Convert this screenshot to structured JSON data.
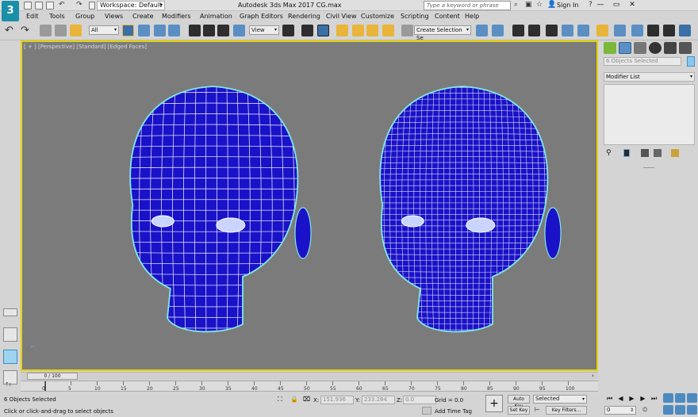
{
  "app": {
    "workspace": "Workspace: Default",
    "title": "Autodesk 3ds Max 2017     CG.max",
    "search_placeholder": "Type a keyword or phrase",
    "signin": "Sign In",
    "logo": "3"
  },
  "menu": [
    "Edit",
    "Tools",
    "Group",
    "Views",
    "Create",
    "Modifiers",
    "Animation",
    "Graph Editors",
    "Rendering",
    "Civil View",
    "Customize",
    "Scripting",
    "Content",
    "Help"
  ],
  "toolbar": {
    "filter_dropdown": "All",
    "view_dropdown": "View",
    "selection_set": "Create Selection Se"
  },
  "viewport": {
    "label": "[ + ] [Perspective] [Standard] [Edged Faces]",
    "object_color": "#1a12c8",
    "wire_color": "#ffffff",
    "highlight_color": "#7fe7e7"
  },
  "command_panel": {
    "selection_field": "6 Objects Selected",
    "modifier_list": "Modifier List"
  },
  "timeline": {
    "frame_counter": "0 / 100",
    "ticks": [
      "0",
      "5",
      "10",
      "15",
      "20",
      "25",
      "30",
      "35",
      "40",
      "45",
      "50",
      "55",
      "60",
      "65",
      "70",
      "75",
      "80",
      "85",
      "90",
      "95",
      "100"
    ]
  },
  "status": {
    "selected_text": "6 Objects Selected",
    "prompt": "Click or click-and-drag to select objects",
    "x_label": "X:",
    "x_value": "151.936",
    "y_label": "Y:",
    "y_value": "233.284",
    "z_label": "Z:",
    "z_value": "0.0",
    "grid": "Grid = 0.0",
    "add_time_tag": "Add Time Tag",
    "auto_key": "Auto Key",
    "set_key": "Set Key",
    "selected_dropdown": "Selected",
    "key_filters": "Key Filters...",
    "frame_value": "0"
  }
}
